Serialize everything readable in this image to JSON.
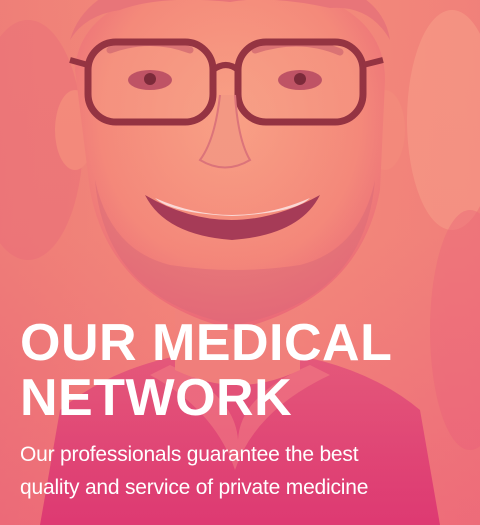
{
  "hero": {
    "image_alt": "Smiling man with glasses",
    "title_lines": [
      "OUR MEDICAL",
      "NETWORK"
    ],
    "subtitle_lines": [
      "Our professionals guarantee the best",
      "quality and service of private medicine"
    ]
  },
  "colors": {
    "overlay_top": "#f58f7a",
    "overlay_bottom": "#e6477a",
    "text": "#ffffff"
  }
}
